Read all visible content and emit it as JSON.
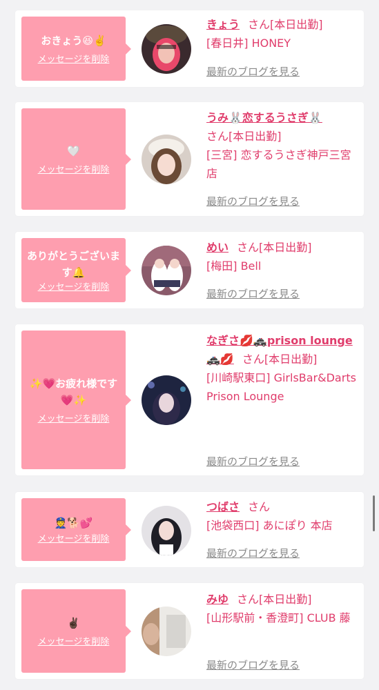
{
  "delete_label": "メッセージを削除",
  "blog_label": "最新のブログを見る",
  "colors": {
    "accent": "#e03c6b",
    "bubble": "#fe9eaf",
    "muted": "#8a8a8a"
  },
  "cards": [
    {
      "message": "おきょう😆✌️",
      "name": "きょう",
      "after_name": "さん[本日出勤]",
      "shop": "[春日井] HONEY"
    },
    {
      "message": "🤍",
      "name": "うみ🐰恋するうさぎ🐰",
      "after_name": "さん[本日出勤]",
      "shop": "[三宮] 恋するうさぎ神戸三宮店"
    },
    {
      "message": "ありがとうございます🔔",
      "name": "めい",
      "after_name": "さん[本日出勤]",
      "shop": "[梅田] Bell"
    },
    {
      "message": "✨💗お疲れ様です💗✨",
      "name": "なぎさ💋🚓prison lounge🚓💋",
      "after_name": "さん[本日出勤]",
      "shop": "[川崎駅東口] GirlsBar&Darts Prison Lounge"
    },
    {
      "message": "👮🐕💕",
      "name": "つばさ",
      "after_name": "さん",
      "shop": "[池袋西口] あにぽり 本店"
    },
    {
      "message": "✌🏿",
      "name": "みゆ",
      "after_name": "さん[本日出勤]",
      "shop": "[山形駅前・香澄町] CLUB 藤"
    }
  ]
}
